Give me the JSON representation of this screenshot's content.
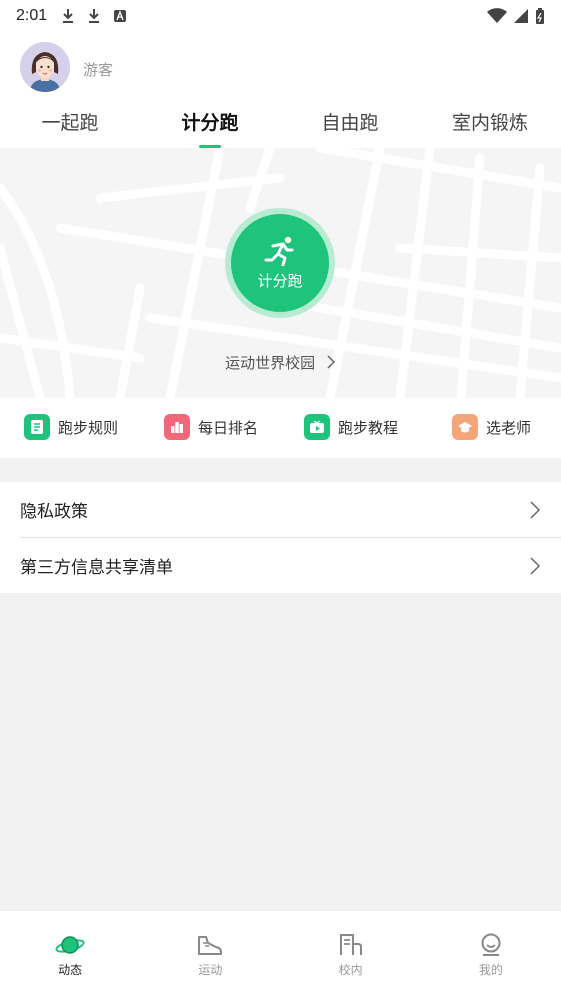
{
  "status_bar": {
    "time": "2:01"
  },
  "user": {
    "name": "游客"
  },
  "tabs": [
    {
      "label": "一起跑"
    },
    {
      "label": "计分跑"
    },
    {
      "label": "自由跑"
    },
    {
      "label": "室内锻炼"
    }
  ],
  "active_tab": "计分跑",
  "start_button": {
    "label": "计分跑"
  },
  "campus_link": {
    "label": "运动世界校园",
    "chevron": ">"
  },
  "quick_actions": [
    {
      "label": "跑步规则",
      "icon": "clipboard-icon",
      "color": "#1ec47c"
    },
    {
      "label": "每日排名",
      "icon": "ranking-icon",
      "color": "#f2687a"
    },
    {
      "label": "跑步教程",
      "icon": "tv-icon",
      "color": "#1ec47c"
    },
    {
      "label": "选老师",
      "icon": "graduation-cap-icon",
      "color": "#f5a57a"
    }
  ],
  "list_items": [
    {
      "label": "隐私政策"
    },
    {
      "label": "第三方信息共享清单"
    }
  ],
  "bottom_nav": [
    {
      "label": "动态",
      "icon": "planet-icon"
    },
    {
      "label": "运动",
      "icon": "shoe-icon"
    },
    {
      "label": "校内",
      "icon": "school-icon"
    },
    {
      "label": "我的",
      "icon": "profile-icon"
    }
  ],
  "active_nav": "动态",
  "colors": {
    "accent": "#1ec47c",
    "ranking": "#f2687a",
    "teacher": "#f5a57a"
  }
}
